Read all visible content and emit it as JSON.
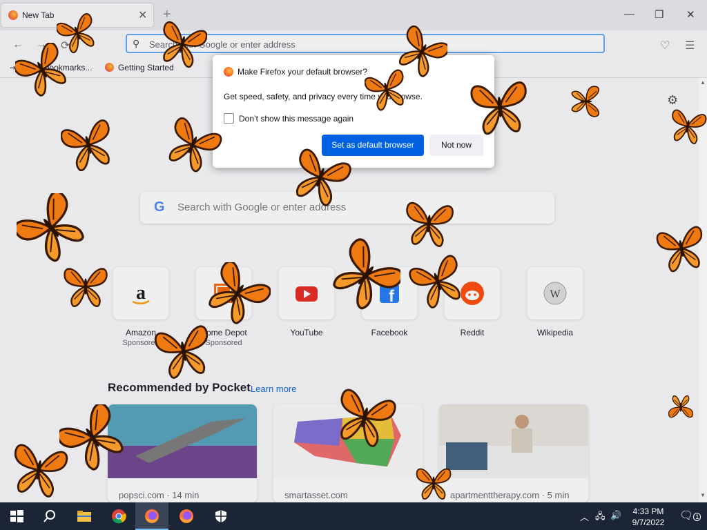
{
  "tab": {
    "title": "New Tab",
    "close": "✕"
  },
  "window": {
    "minimize": "—",
    "restore": "❐",
    "close": "✕",
    "newtab": "+"
  },
  "nav": {
    "back": "←",
    "forward": "→",
    "reload": "⟳",
    "url_placeholder": "Search with Google or enter address",
    "pocket": "♡",
    "menu": "☰"
  },
  "bookmarks": {
    "import": "Import bookmarks...",
    "getting_started": "Getting Started"
  },
  "dialog": {
    "title": "Make Firefox your default browser?",
    "body": "Get speed, safety, and privacy every time you browse.",
    "checkbox_label": "Don’t show this message again",
    "primary": "Set as default browser",
    "secondary": "Not now"
  },
  "search": {
    "placeholder": "Search with Google or enter address",
    "g": "G"
  },
  "top_sites": [
    {
      "label": "Amazon",
      "sponsored": "Sponsored",
      "icon": "amazon-icon"
    },
    {
      "label": "Home Depot",
      "sponsored": "Sponsored",
      "icon": "home-depot-icon"
    },
    {
      "label": "YouTube",
      "sponsored": "",
      "icon": "youtube-icon"
    },
    {
      "label": "Facebook",
      "sponsored": "",
      "icon": "facebook-icon"
    },
    {
      "label": "Reddit",
      "sponsored": "",
      "icon": "reddit-icon"
    },
    {
      "label": "Wikipedia",
      "sponsored": "",
      "icon": "wikipedia-icon"
    }
  ],
  "pocket": {
    "heading": "Recommended by Pocket",
    "learn_more": "Learn more",
    "cards": [
      {
        "source": "popsci.com · 14 min"
      },
      {
        "source": "smartasset.com"
      },
      {
        "source": "apartmenttherapy.com · 5 min"
      }
    ]
  },
  "taskbar": {
    "time": "4:33 PM",
    "date": "9/7/2022",
    "notif_count": "1"
  },
  "colors": {
    "accent": "#0061e0",
    "taskbar": "#1b2536",
    "butterfly": "#f07a12"
  }
}
